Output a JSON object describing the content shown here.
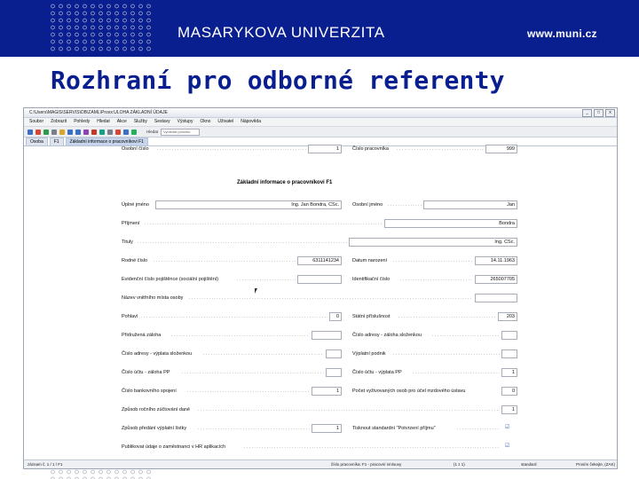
{
  "header": {
    "university": "MASARYKOVA UNIVERZITA",
    "website": "www.muni.cz",
    "brand_color": "#0a1f8f"
  },
  "slide": {
    "title": "Rozhraní pro odborné referenty"
  },
  "window": {
    "title_bar": "C:\\Users\\MAGIS\\SERVIS\\DB\\ZAML\\Proxx:ULOHA ZÁKLADNÍ ÚDAJE",
    "controls": [
      "_",
      "□",
      "x"
    ],
    "menu": [
      "Soubor",
      "Zobrazit",
      "Pohledy",
      "Hledat",
      "Akce",
      "Služby",
      "Sestavy",
      "Výstupy",
      "Okno",
      "Uživatel",
      "Nápověda"
    ],
    "toolbar_field_label": "Hledat",
    "toolbar_field_placeholder": "Vyhledat položku",
    "tabs": [
      "Osoba",
      "F1",
      "Základní informace o pracovníkovi F1"
    ]
  },
  "form": {
    "osobni_cislo": {
      "label": "Osobní číslo",
      "value": "1"
    },
    "cislo_pracovnika": {
      "label": "Číslo pracovníka",
      "value": "999"
    },
    "section_title": "Základní informace o pracovníkovi F1",
    "uplne_jmeno": {
      "label": "Úplné jméno",
      "value": "Ing. Jan Bondra, CSc."
    },
    "osobni_jmeno": {
      "label": "Osobní jméno",
      "value": "Jan"
    },
    "prijmeni": {
      "label": "Příjmení",
      "value": "Bondra"
    },
    "tituly": {
      "label": "Tituly",
      "value": "Ing. CSc."
    },
    "rodne_cislo": {
      "label": "Rodné číslo",
      "value": "6311141234"
    },
    "datum_narozeni": {
      "label": "Datum narození",
      "value": "14.11.1963"
    },
    "evidencni_cislo": {
      "label": "Evidenční číslo pojištěnce (sociální pojištění)",
      "value": ""
    },
    "identifikacni_cislo": {
      "label": "Identifikační číslo",
      "value": "265007705"
    },
    "nazev_mista": {
      "label": "Název vnitřního místa osoby",
      "value": ""
    },
    "pohlavi": {
      "label": "Pohlaví",
      "value": "0"
    },
    "statni_prislusnost": {
      "label": "Státní příslušnost",
      "value": "203"
    },
    "pridruzena_zaloha": {
      "label": "Přidružená záloha",
      "value": ""
    },
    "cislo_adresy_sloz": {
      "label": "Číslo adresy - záloha složenkou",
      "value": ""
    },
    "cislo_adresy_vyp": {
      "label": "Číslo adresy - výplata složenkou",
      "value": ""
    },
    "vyplatni_podnik": {
      "label": "Výplatní podnik",
      "value": ""
    },
    "cislo_uctu_zal": {
      "label": "Číslo účtu - záloha PP",
      "value": ""
    },
    "cislo_uctu_vyp": {
      "label": "Číslo účtu - výplata PP",
      "value": "1"
    },
    "cislo_bankovniho": {
      "label": "Číslo bankovního spojení",
      "value": "1"
    },
    "pocet_vyzivovanych": {
      "label": "Počet vyživovaných osob pro účel mzdového ústavu",
      "value": "0"
    },
    "zpusob_zuctovani": {
      "label": "Způsob ročního zúčtování daně",
      "value": "1"
    },
    "zpusob_predani": {
      "label": "Způsob předání výplatní lístky",
      "value": "1"
    },
    "tisknout_standard": {
      "label": "Tisknout standardní \"Potvrzení příjmu\"",
      "value": "☑"
    },
    "publikovat": {
      "label": "Publikovat údaje o zaměstnanci v HR aplikacích",
      "value": "☑"
    }
  },
  "status_bar": {
    "left": "záznam č. 1 / 1 / F1",
    "middle": "číslo pracovníka: F1 - pracovní smlouvy",
    "count": "(1 z 1)",
    "mode": "standard",
    "right": "Prosím čekejte, (ZAK)"
  }
}
